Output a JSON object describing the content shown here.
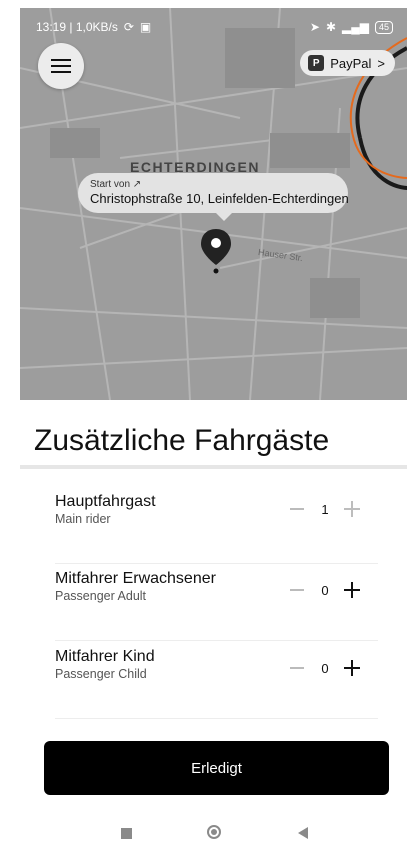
{
  "status_bar": {
    "time_and_speed": "13:19 | 1,0KB/s",
    "battery": "45"
  },
  "map": {
    "town_label": "ECHTERDINGEN",
    "street_label": "Hauser Str.",
    "start_label": "Start von ↗",
    "start_address": "Christophstraße 10, Leinfelden-Echterdingen",
    "payment_chip": "PayPal",
    "payment_chevron": ">"
  },
  "sheet": {
    "title": "Zusätzliche Fahrgäste",
    "rows": [
      {
        "label": "Hauptfahrgast",
        "sublabel": "Main rider",
        "count": "1"
      },
      {
        "label": "Mitfahrer Erwachsener",
        "sublabel": "Passenger Adult",
        "count": "0"
      },
      {
        "label": "Mitfahrer Kind",
        "sublabel": "Passenger Child",
        "count": "0"
      }
    ],
    "done_button": "Erledigt"
  },
  "icons": [
    "menu-icon",
    "paypal-icon",
    "location-pin-icon",
    "gps-icon",
    "bluetooth-icon",
    "signal-icon",
    "battery-icon"
  ],
  "colors": {
    "map_background": "#9d9d9d",
    "button_background": "#000000",
    "route_accent": "#e56a1d"
  }
}
